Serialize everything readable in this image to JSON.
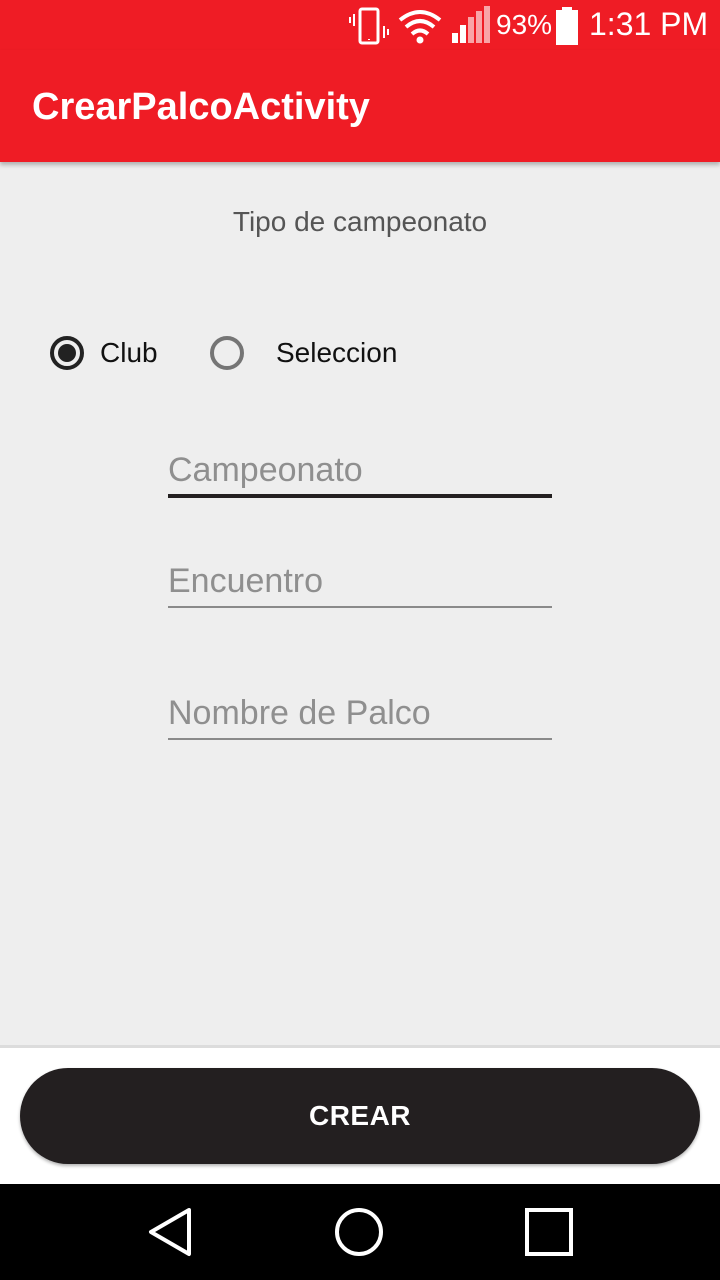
{
  "status_bar": {
    "battery_percent": "93%",
    "time": "1:31 PM",
    "icons": [
      "vibrate-icon",
      "wifi-icon",
      "signal-icon",
      "battery-icon"
    ]
  },
  "app_bar": {
    "title": "CrearPalcoActivity"
  },
  "form": {
    "subtitle": "Tipo de campeonato",
    "radios": [
      {
        "label": "Club",
        "checked": true
      },
      {
        "label": "Seleccion",
        "checked": false
      }
    ],
    "fields": {
      "campeonato": {
        "value": "",
        "placeholder": "Campeonato"
      },
      "encuentro": {
        "value": "",
        "placeholder": "Encuentro"
      },
      "nombre_palco": {
        "value": "",
        "placeholder": "Nombre de Palco"
      }
    }
  },
  "actions": {
    "crear_label": "CREAR"
  },
  "nav_bar": {
    "icons": [
      "back-icon",
      "home-icon",
      "recents-icon"
    ]
  },
  "colors": {
    "accent": "#ef1c25",
    "background": "#eeeeee",
    "button": "#231f20"
  }
}
